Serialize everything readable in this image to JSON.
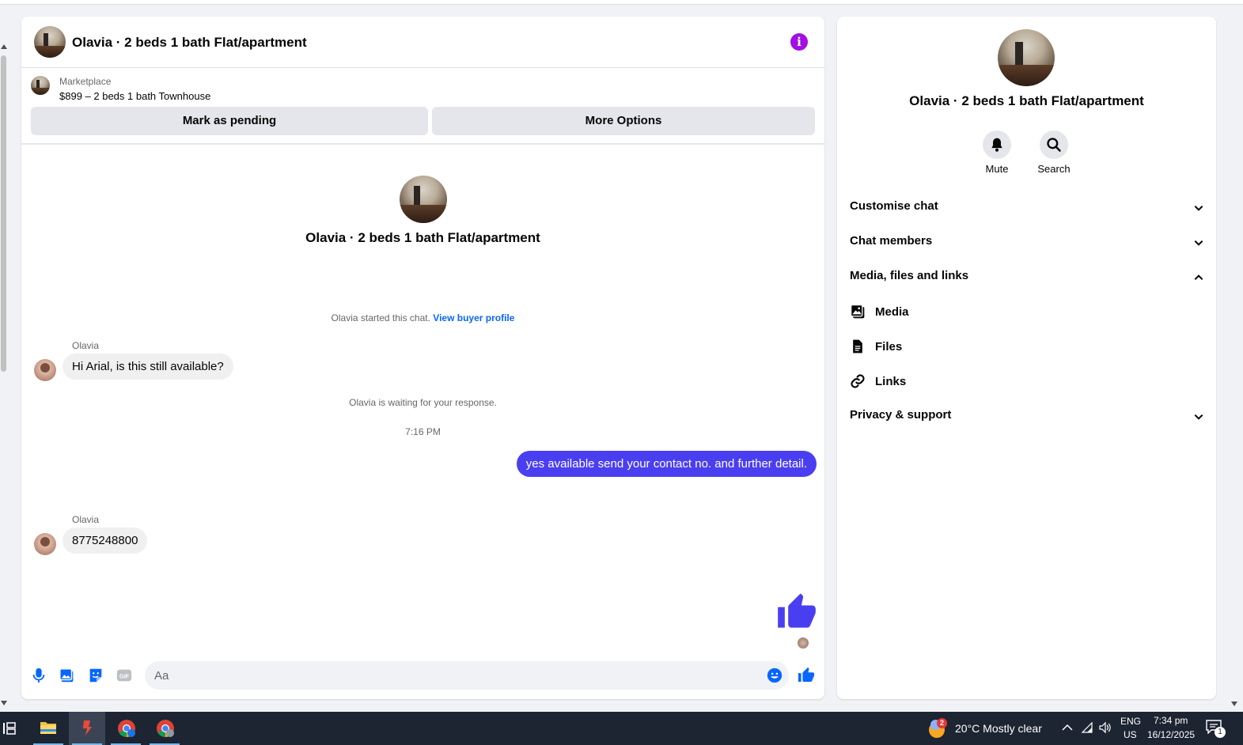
{
  "chat_header": {
    "title": "Olavia · 2 beds 1 bath Flat/apartment",
    "info_icon": "info-icon"
  },
  "marketplace": {
    "label": "Marketplace",
    "listing": "$899 – 2 beds 1 bath Townhouse",
    "mark_pending_label": "Mark as pending",
    "more_options_label": "More Options"
  },
  "conversation": {
    "title": "Olavia · 2 beds 1 bath Flat/apartment",
    "started_text": "Olavia started this chat.",
    "view_profile_link": "View buyer profile",
    "messages": [
      {
        "sender": "Olavia",
        "text": "Hi Arial, is this still available?"
      },
      {
        "text": "yes available send your contact no. and further detail."
      },
      {
        "sender": "Olavia",
        "text": "8775248800"
      }
    ],
    "waiting_text": "Olavia is waiting for your response.",
    "timestamp": "7:16 PM"
  },
  "composer": {
    "placeholder": "Aa",
    "icons": [
      "microphone-icon",
      "photo-icon",
      "sticker-icon",
      "gif-icon",
      "emoji-icon",
      "thumbs-up-icon"
    ],
    "gif_text": "GIF"
  },
  "side_panel": {
    "title": "Olavia · 2 beds 1 bath Flat/apartment",
    "mute_label": "Mute",
    "search_label": "Search",
    "sections": {
      "customise": "Customise chat",
      "members": "Chat members",
      "media_files_links": "Media, files and links",
      "privacy": "Privacy & support"
    },
    "sub_items": {
      "media": "Media",
      "files": "Files",
      "links": "Links"
    }
  },
  "taskbar": {
    "weather_badge": "2",
    "weather": "20°C  Mostly clear",
    "lang_top": "ENG",
    "lang_bottom": "US",
    "time": "7:34 pm",
    "date": "16/12/2025",
    "notification_count": "1"
  },
  "colors": {
    "accent_blue": "#0866ff",
    "outgoing_bubble": "#4a3ff0",
    "info_purple": "#a20ee3",
    "taskbar": "#1d2432"
  }
}
